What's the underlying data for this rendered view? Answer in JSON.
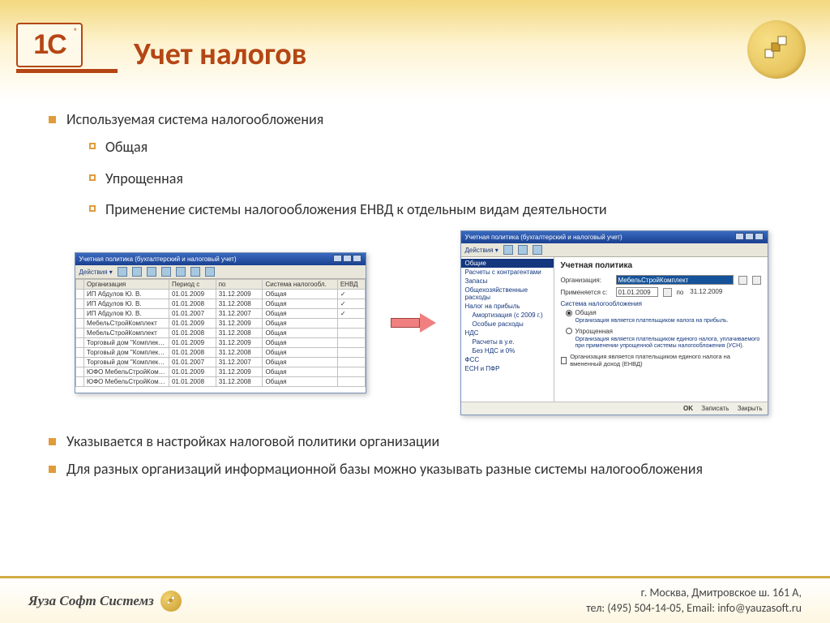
{
  "title": "Учет налогов",
  "bullets": {
    "b1": "Используемая система налогообложения",
    "b1_1": "Общая",
    "b1_2": "Упрощенная",
    "b1_3": "Применение системы налогообложения ЕНВД к отдельным видам деятельности",
    "b2": "Указывается в настройках налоговой политики организации",
    "b3": "Для разных организаций информационной базы можно указывать разные системы налогообложения"
  },
  "win1": {
    "title": "Учетная политика (бухгалтерский и налоговый учет)",
    "actions": "Действия ▾",
    "headers": {
      "org": "Организация",
      "from": "Период с",
      "to": "по",
      "sys": "Система налогообл.",
      "envd": "ЕНВД"
    },
    "rows": [
      {
        "org": "ИП Абдулов Ю. В.",
        "from": "01.01.2009",
        "to": "31.12.2009",
        "sys": "Общая",
        "envd": true
      },
      {
        "org": "ИП Абдулов Ю. В.",
        "from": "01.01.2008",
        "to": "31.12.2008",
        "sys": "Общая",
        "envd": true
      },
      {
        "org": "ИП Абдулов Ю. В.",
        "from": "01.01.2007",
        "to": "31.12.2007",
        "sys": "Общая",
        "envd": true
      },
      {
        "org": "МебельСтройКомплект",
        "from": "01.01.2009",
        "to": "31.12.2009",
        "sys": "Общая",
        "envd": false
      },
      {
        "org": "МебельСтройКомплект",
        "from": "01.01.2008",
        "to": "31.12.2008",
        "sys": "Общая",
        "envd": false
      },
      {
        "org": "Торговый дом \"Комплек…",
        "from": "01.01.2009",
        "to": "31.12.2009",
        "sys": "Общая",
        "envd": false
      },
      {
        "org": "Торговый дом \"Комплек…",
        "from": "01.01.2008",
        "to": "31.12.2008",
        "sys": "Общая",
        "envd": false
      },
      {
        "org": "Торговый дом \"Комплек…",
        "from": "01.01.2007",
        "to": "31.12.2007",
        "sys": "Общая",
        "envd": false
      },
      {
        "org": "ЮФО МебельСтройКомп…",
        "from": "01.01.2009",
        "to": "31.12.2009",
        "sys": "Общая",
        "envd": false
      },
      {
        "org": "ЮФО МебельСтройКомп…",
        "from": "01.01.2008",
        "to": "31.12.2008",
        "sys": "Общая",
        "envd": false
      }
    ]
  },
  "win2": {
    "title": "Учетная политика (бухгалтерский и налоговый учет)",
    "actions": "Действия ▾",
    "nav": {
      "n0": "Общие",
      "n1": "Расчеты с контрагентами",
      "n2": "Запасы",
      "n3": "Общехозяйственные расходы",
      "n4": "Налог на прибыль",
      "n5": "Амортизация (с 2009 г.)",
      "n6": "Особые расходы",
      "n7": "НДС",
      "n8": "Расчеты в у.е.",
      "n9": "Без НДС и 0%",
      "n10": "ФСС",
      "n11": "ЕСН и ПФР"
    },
    "form": {
      "heading": "Учетная политика",
      "org_label": "Организация:",
      "org_value": "МебельСтройКомплект",
      "period_label": "Применяется с:",
      "period_from": "01.01.2009",
      "period_to_lbl": "по",
      "period_to": "31.12.2009",
      "group_title": "Система налогообложения",
      "radio1": "Общая",
      "hint1": "Организация является плательщиком налога на прибыль.",
      "radio2": "Упрощенная",
      "hint2": "Организация является плательщиком единого налога, уплачиваемого при применении упрощенной системы налогообложения (УСН).",
      "chk_label": "Организация является плательщиком единого налога на вмененный доход (ЕНВД)"
    },
    "footer": {
      "ok": "OK",
      "save": "Записать",
      "close": "Закрыть"
    }
  },
  "footer": {
    "brand": "Яуза Софт Системз",
    "addr": "г. Москва, Дмитровское ш. 161 А,",
    "contact": "тел: (495) 504-14-05, Email: info@yauzasoft.ru"
  }
}
